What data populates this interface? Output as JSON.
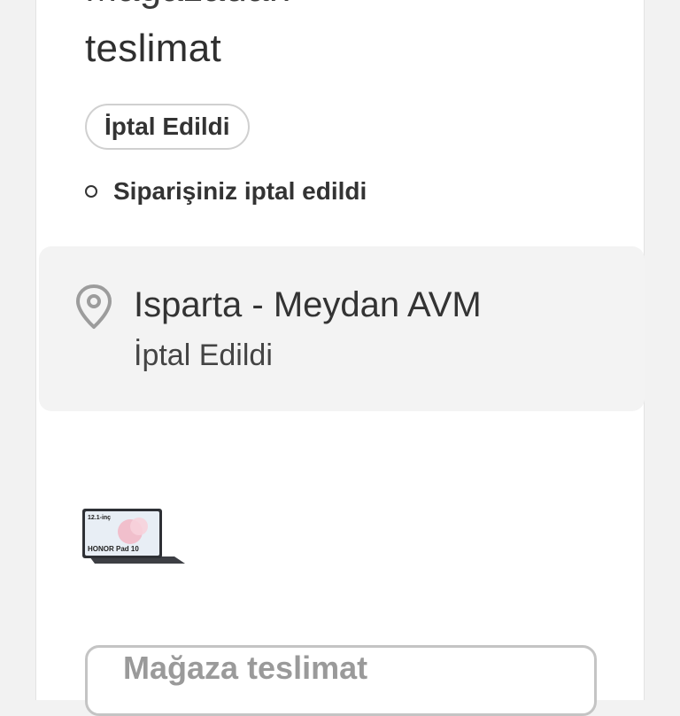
{
  "delivery": {
    "title_line1": "Mağazadan",
    "title_line2": "teslimat",
    "status_badge": "İptal Edildi"
  },
  "timeline": {
    "items": [
      {
        "text": "Siparişiniz iptal edildi"
      }
    ]
  },
  "store": {
    "name": "Isparta - Meydan AVM",
    "status": "İptal Edildi",
    "icon": "location-pin-icon"
  },
  "product": {
    "image_text_size": "12.1-inç",
    "image_text_brand": "HONOR Pad 10"
  },
  "button": {
    "label": "Mağaza teslimat"
  },
  "colors": {
    "page_bg": "#f2f2f2",
    "card_bg": "#ffffff",
    "store_box_bg": "#f3f3f3",
    "text_primary": "#333333",
    "button_text": "#9a9a9a",
    "border": "#c4c4c4"
  }
}
